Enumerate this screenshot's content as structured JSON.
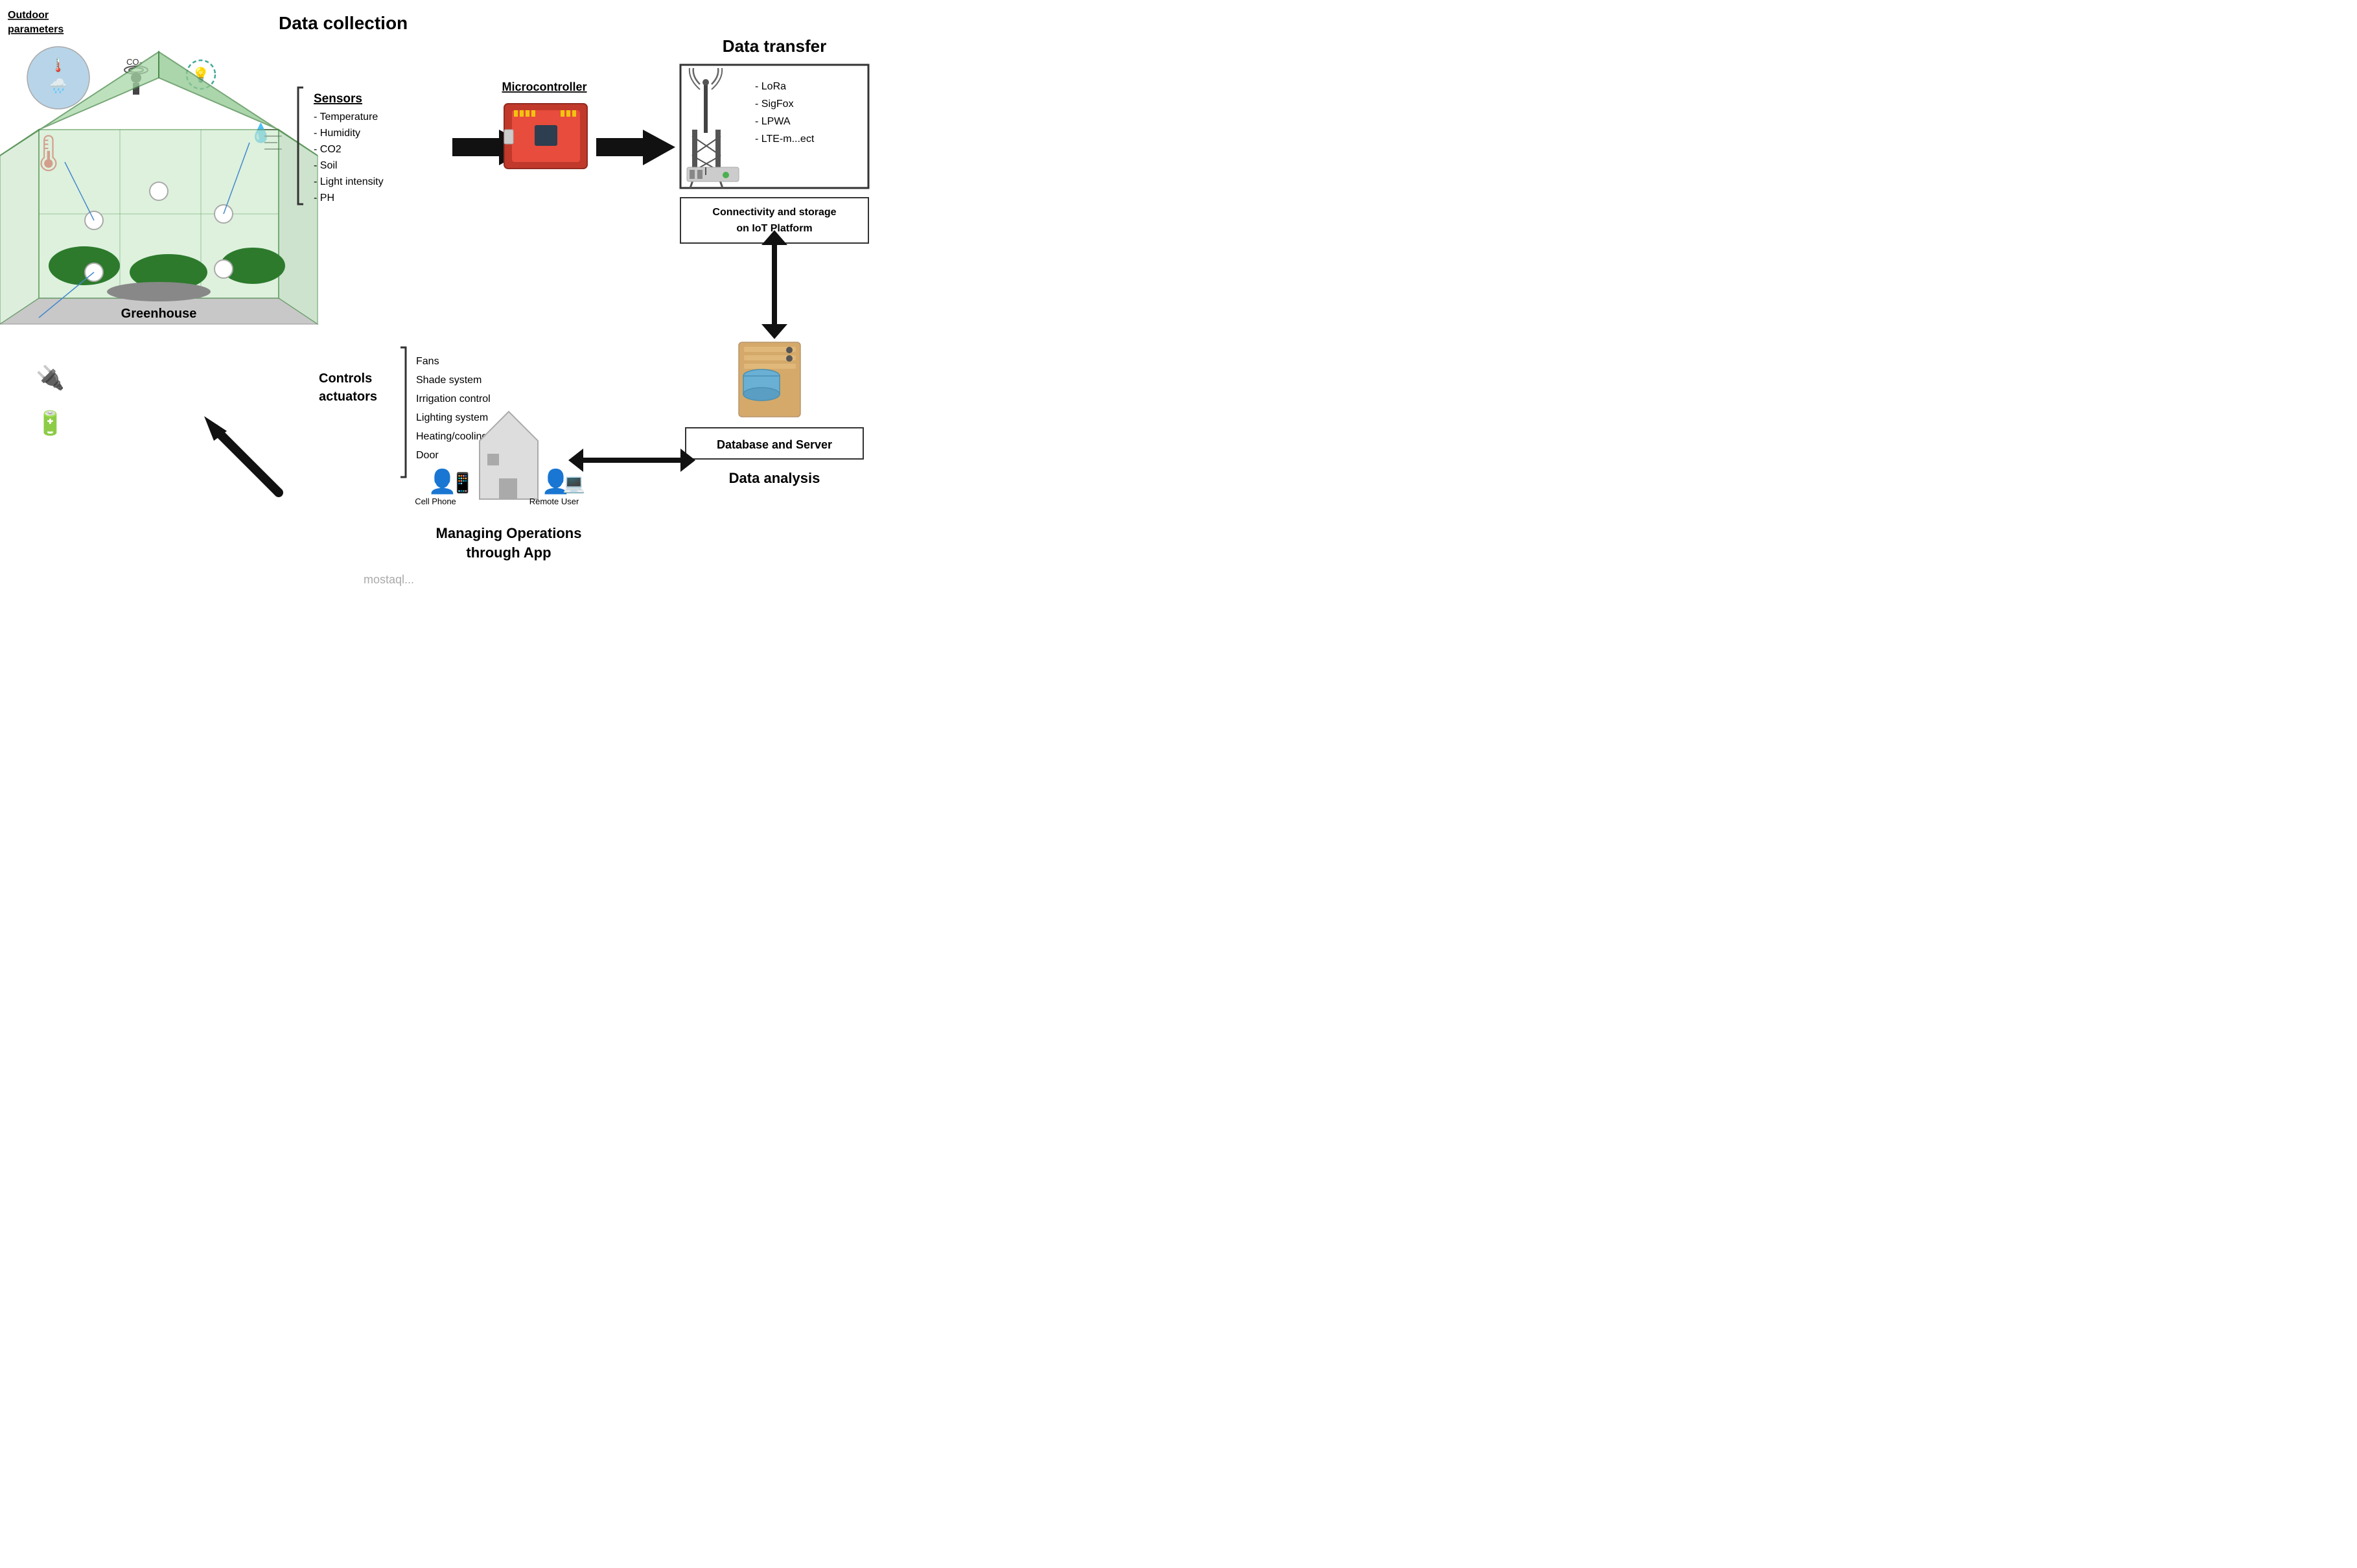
{
  "title": "Data collection",
  "outdoor": {
    "label": "Outdoor\nparameters"
  },
  "greenhouse": {
    "label": "Greenhouse"
  },
  "sensors": {
    "title": "Sensors",
    "items": [
      "Temperature",
      "Humidity",
      "CO2",
      "Soil",
      "Light intensity",
      "PH"
    ]
  },
  "microcontroller": {
    "title": "Microcontroller"
  },
  "dataTransfer": {
    "title": "Data transfer",
    "protocols": [
      "LoRa",
      "SigFox",
      "LPWA",
      "LTE-m...ect"
    ],
    "connectivity": "Connectivity and storage\non IoT Platform"
  },
  "controls": {
    "title": "Controls\nactuators",
    "items": [
      "Fans",
      "Shade system",
      "Irrigation control",
      "Lighting system",
      "Heating/cooling system",
      "Door"
    ]
  },
  "database": {
    "label": "Database and Server"
  },
  "dataAnalysis": {
    "title": "Data analysis"
  },
  "managing": {
    "title": "Managing Operations\nthrough App",
    "cellPhone": "Cell Phone",
    "remoteUser": "Remote User"
  },
  "watermark": "mostaql..."
}
